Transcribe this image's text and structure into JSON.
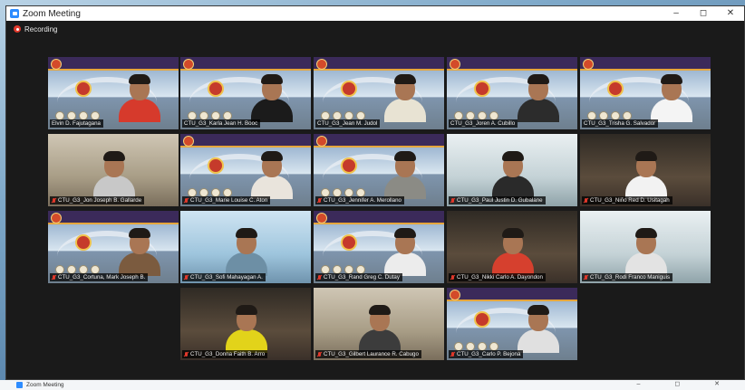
{
  "window": {
    "title": "Zoom Meeting",
    "controls": {
      "minimize": "–",
      "maximize": "◻",
      "close": "✕"
    }
  },
  "recording": {
    "label": "Recording"
  },
  "participants": [
    {
      "name": "Elvin D. Fajutagana",
      "background": "banner",
      "active": true,
      "muted": false,
      "shirt": "#d63a2c"
    },
    {
      "name": "CTU_G3_Karla Jean H. Booc",
      "background": "banner",
      "muted": false,
      "shirt": "#1b1b1b"
    },
    {
      "name": "CTU_G3_Jean M. Judol",
      "background": "banner",
      "muted": false,
      "shirt": "#e8e3d3"
    },
    {
      "name": "CTU_G3_Joren A. Cubillo",
      "background": "banner",
      "muted": false,
      "shirt": "#2c2c2c"
    },
    {
      "name": "CTU_G3_Trisha G. Salvador",
      "background": "banner",
      "muted": false,
      "shirt": "#f4f4f4"
    },
    {
      "name": "CTU_G3_Jon Joseph B. Gallarde",
      "background": "room",
      "muted": true,
      "shirt": "#c8c8c8"
    },
    {
      "name": "CTU_G3_Marie Louise C. Aton",
      "background": "banner",
      "muted": true,
      "shirt": "#e9e4dc"
    },
    {
      "name": "CTU_G3_Jennifer A. Merollano",
      "background": "banner",
      "muted": true,
      "shirt": "#8b8b85"
    },
    {
      "name": "CTU_G3_Paul Justin D. Gubalane",
      "background": "light",
      "muted": true,
      "shirt": "#2a2a2a"
    },
    {
      "name": "CTU_G3_Niño Red D. Usitagah",
      "background": "dark",
      "muted": true,
      "shirt": "#f2f2f2"
    },
    {
      "name": "CTU_G3_Cortuna, Mark Joseph B.",
      "background": "banner",
      "muted": true,
      "shirt": "#7b5b3f"
    },
    {
      "name": "CTU_G3_Sofi Mahayagan A.",
      "background": "sky",
      "muted": true,
      "shirt": "#6d8fa5"
    },
    {
      "name": "CTU_G3_Rand Greg C. Dutay",
      "background": "banner",
      "muted": true,
      "shirt": "#ececec"
    },
    {
      "name": "CTU_G3_Nikki Carlo A. Dayondon",
      "background": "dark",
      "muted": true,
      "shirt": "#d6402e"
    },
    {
      "name": "CTU_G3_Rodi Franco Maniguis",
      "background": "light",
      "muted": true,
      "shirt": "#e3e3e3"
    },
    {
      "name": "CTU_G3_Donna Faith B. Arro",
      "background": "dark",
      "muted": true,
      "shirt": "#e2d31a"
    },
    {
      "name": "CTU_G3_Gilbert Laurance R. Cabugo",
      "background": "room",
      "muted": true,
      "shirt": "#3c3c3c"
    },
    {
      "name": "CTU_G3_Carlo P. Bejona",
      "background": "banner",
      "muted": true,
      "shirt": "#e0e0e0"
    }
  ],
  "taskbar": {
    "title": "Zoom Meeting",
    "controls": "– ◻ ✕"
  }
}
